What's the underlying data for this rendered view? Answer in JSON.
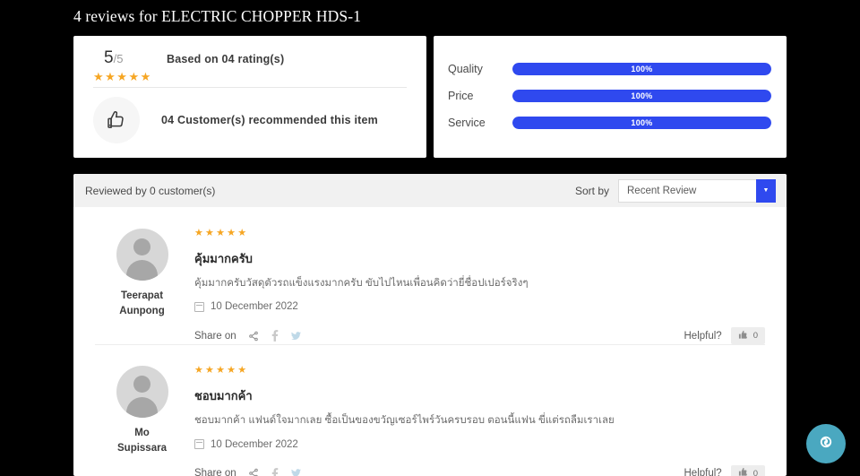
{
  "page": {
    "title": "4 reviews for ELECTRIC CHOPPER HDS-1",
    "background_color": "#000000",
    "accent_color": "#2f49ef",
    "star_color": "#f6a623"
  },
  "rating_summary": {
    "score": "5",
    "score_denominator": "/5",
    "stars": "★★★★★",
    "based_on": "Based on 04 rating(s)",
    "thumb_icon": "thumbs-up-icon",
    "recommend_text": "04  Customer(s) recommended this item"
  },
  "rating_bars": [
    {
      "label": "Quality",
      "value": 100,
      "value_label": "100%"
    },
    {
      "label": "Price",
      "value": 100,
      "value_label": "100%"
    },
    {
      "label": "Service",
      "value": 100,
      "value_label": "100%"
    }
  ],
  "reviews_header": {
    "reviewed_by": "Reviewed by 0 customer(s)",
    "sort_label": "Sort by",
    "sort_selected": "Recent Review",
    "sort_options": [
      "Recent Review"
    ],
    "arrow_icon": "chevron-down-icon"
  },
  "reviews": [
    {
      "reviewer_name_line1": "Teerapat",
      "reviewer_name_line2": "Aunpong",
      "stars": "★★★★★",
      "title": "คุ้มมากครับ",
      "text": "คุ้มมากครับวัสดุตัวรถแข็งแรงมากครับ ขับไปไหนเพื่อนคิดว่ายี่ชื่อปเปอร์จริงๆ",
      "date": "10 December 2022",
      "share_label": "Share on",
      "share_icons": [
        "share-icon",
        "facebook-icon",
        "twitter-icon"
      ],
      "helpful_label": "Helpful?",
      "helpful_count": "0",
      "helpful_icon": "thumbs-up-icon"
    },
    {
      "reviewer_name_line1": "Mo",
      "reviewer_name_line2": "Supissara",
      "stars": "★★★★★",
      "title": "ชอบมากค้า",
      "text": "ชอบมากค้า แฟนด์ใจมากเลย ซื้อเป็นของขวัญเซอร์ไพร์วันครบรอบ ตอนนี้แฟน ขี่แต่รถลืมเราเลย",
      "date": "10 December 2022",
      "share_label": "Share on",
      "share_icons": [
        "share-icon",
        "facebook-icon",
        "twitter-icon"
      ],
      "helpful_label": "Helpful?",
      "helpful_count": "0",
      "helpful_icon": "thumbs-up-icon"
    }
  ],
  "chat_widget": {
    "icon": "chat-spiral-icon",
    "color": "#4aa8c0"
  }
}
